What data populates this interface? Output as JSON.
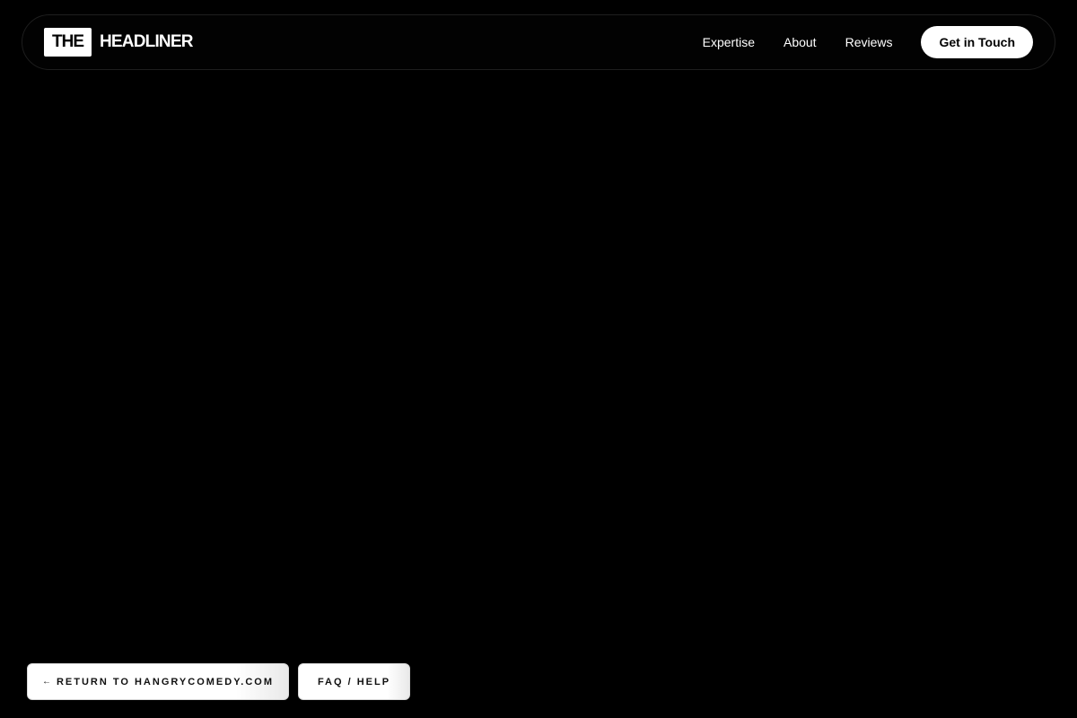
{
  "header": {
    "brand": {
      "box_text": "THE",
      "name": "HEADLINER"
    },
    "nav_links": [
      {
        "label": "Expertise"
      },
      {
        "label": "About"
      },
      {
        "label": "Reviews"
      }
    ],
    "cta_label": "Get in Touch"
  },
  "footer_actions": {
    "return_arrow_icon": "←",
    "return_label": "RETURN TO HANGRYCOMEDY.COM",
    "faq_label": "FAQ / HELP"
  },
  "colors": {
    "background": "#000000",
    "foreground": "#ffffff",
    "nav_border": "#1e1e1e"
  },
  "icons": {
    "return_icon": "arrow-left-icon"
  }
}
